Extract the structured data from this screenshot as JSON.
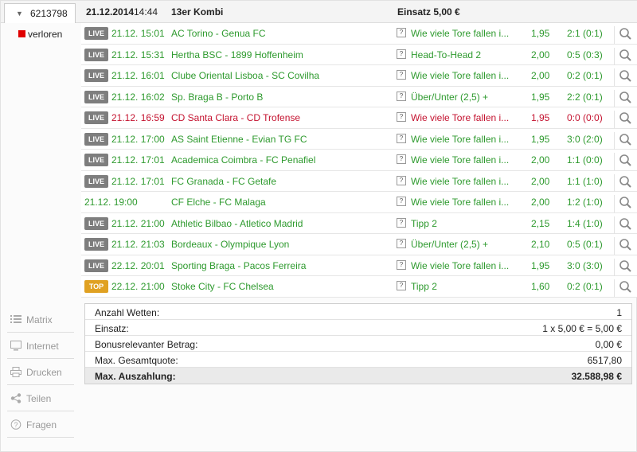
{
  "header": {
    "bet_id": "6213798",
    "date": "21.12.2014",
    "time": "14:44",
    "kombi": "13er Kombi",
    "einsatz": "Einsatz 5,00 €"
  },
  "status": {
    "label": "verloren",
    "color": "#e00000"
  },
  "colors": {
    "win": "#2e9a2e",
    "loss": "#c4122f",
    "live_badge": "#7e7e7e",
    "top_badge": "#e0a122"
  },
  "rows": [
    {
      "badge": "LIVE",
      "datetime": "21.12. 15:01",
      "match": "AC Torino - Genua FC",
      "market": "Wie viele Tore fallen i...",
      "odds": "1,95",
      "result": "2:1 (0:1)",
      "state": "win"
    },
    {
      "badge": "LIVE",
      "datetime": "21.12. 15:31",
      "match": "Hertha BSC - 1899 Hoffenheim",
      "market": "Head-To-Head 2",
      "odds": "2,00",
      "result": "0:5 (0:3)",
      "state": "win"
    },
    {
      "badge": "LIVE",
      "datetime": "21.12. 16:01",
      "match": "Clube Oriental Lisboa - SC Covilha",
      "market": "Wie viele Tore fallen i...",
      "odds": "2,00",
      "result": "0:2 (0:1)",
      "state": "win"
    },
    {
      "badge": "LIVE",
      "datetime": "21.12. 16:02",
      "match": "Sp. Braga B - Porto B",
      "market": "Über/Unter (2,5) +",
      "odds": "1,95",
      "result": "2:2 (0:1)",
      "state": "win"
    },
    {
      "badge": "LIVE",
      "datetime": "21.12. 16:59",
      "match": "CD Santa Clara - CD Trofense",
      "market": "Wie viele Tore fallen i...",
      "odds": "1,95",
      "result": "0:0 (0:0)",
      "state": "loss"
    },
    {
      "badge": "LIVE",
      "datetime": "21.12. 17:00",
      "match": "AS Saint Etienne - Evian TG FC",
      "market": "Wie viele Tore fallen i...",
      "odds": "1,95",
      "result": "3:0 (2:0)",
      "state": "win"
    },
    {
      "badge": "LIVE",
      "datetime": "21.12. 17:01",
      "match": "Academica Coimbra - FC Penafiel",
      "market": "Wie viele Tore fallen i...",
      "odds": "2,00",
      "result": "1:1 (0:0)",
      "state": "win"
    },
    {
      "badge": "LIVE",
      "datetime": "21.12. 17:01",
      "match": "FC Granada - FC Getafe",
      "market": "Wie viele Tore fallen i...",
      "odds": "2,00",
      "result": "1:1 (1:0)",
      "state": "win"
    },
    {
      "badge": "",
      "datetime": "21.12. 19:00",
      "match": "CF Elche - FC Malaga",
      "market": "Wie viele Tore fallen i...",
      "odds": "2,00",
      "result": "1:2 (1:0)",
      "state": "win"
    },
    {
      "badge": "LIVE",
      "datetime": "21.12. 21:00",
      "match": "Athletic Bilbao - Atletico Madrid",
      "market": "Tipp 2",
      "odds": "2,15",
      "result": "1:4 (1:0)",
      "state": "win"
    },
    {
      "badge": "LIVE",
      "datetime": "21.12. 21:03",
      "match": "Bordeaux - Olympique Lyon",
      "market": "Über/Unter (2,5) +",
      "odds": "2,10",
      "result": "0:5 (0:1)",
      "state": "win"
    },
    {
      "badge": "LIVE",
      "datetime": "22.12. 20:01",
      "match": "Sporting Braga - Pacos Ferreira",
      "market": "Wie viele Tore fallen i...",
      "odds": "1,95",
      "result": "3:0 (3:0)",
      "state": "win"
    },
    {
      "badge": "TOP",
      "datetime": "22.12. 21:00",
      "match": "Stoke City - FC Chelsea",
      "market": "Tipp 2",
      "odds": "1,60",
      "result": "0:2 (0:1)",
      "state": "win"
    }
  ],
  "side_menu": [
    {
      "label": "Matrix",
      "icon": "list-icon"
    },
    {
      "label": "Internet",
      "icon": "monitor-icon"
    },
    {
      "label": "Drucken",
      "icon": "printer-icon"
    },
    {
      "label": "Teilen",
      "icon": "share-icon"
    },
    {
      "label": "Fragen",
      "icon": "help-icon"
    }
  ],
  "summary": [
    {
      "key": "Anzahl Wetten:",
      "value": "1"
    },
    {
      "key": "Einsatz:",
      "value": "1 x 5,00 € = 5,00 €"
    },
    {
      "key": "Bonusrelevanter Betrag:",
      "value": "0,00 €"
    },
    {
      "key": "Max. Gesamtquote:",
      "value": "6517,80"
    },
    {
      "key": "Max. Auszahlung:",
      "value": "32.588,98 €"
    }
  ]
}
